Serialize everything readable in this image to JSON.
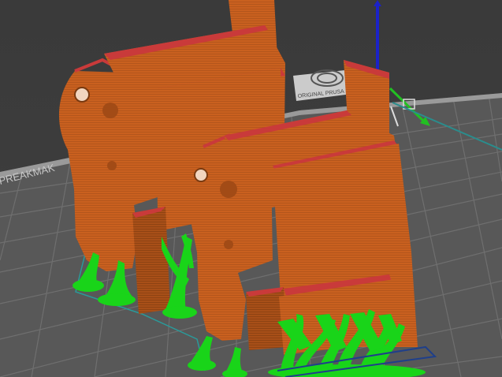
{
  "viewport": {
    "bed_logo": "PRUSA",
    "bed_brand_text": "ORIGINAL PRUSA",
    "bed_edge_text": "PREAKMAK"
  },
  "colors": {
    "background": "#3b3b3b",
    "bed": "#5a5a5a",
    "bed_grid": "#707070",
    "model": "#c9601f",
    "model_dark": "#a24b16",
    "perimeter_top": "#c93a3a",
    "support": "#19d419",
    "axis_z": "#1b22c8",
    "axis_y": "#22c022",
    "build_outline": "#2a9a9a"
  },
  "icons": {
    "z_axis": "z-axis-arrow-icon",
    "y_axis": "y-axis-arrow-icon"
  }
}
